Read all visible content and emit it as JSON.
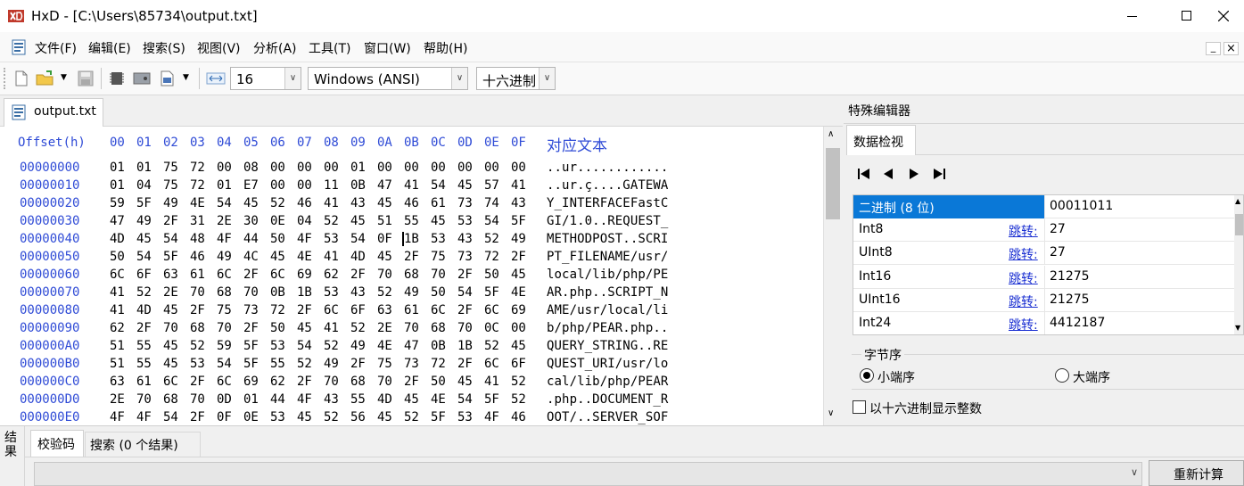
{
  "window": {
    "title": "HxD - [C:\\Users\\85734\\output.txt]",
    "minimize": "—",
    "maximize": "☐",
    "close": "✕"
  },
  "menu": {
    "items": [
      "文件(F)",
      "编辑(E)",
      "搜索(S)",
      "视图(V)",
      "分析(A)",
      "工具(T)",
      "窗口(W)",
      "帮助(H)"
    ],
    "mdi_min": "_",
    "mdi_close": "×"
  },
  "toolbar": {
    "bytes_per_row": "16",
    "charset": "Windows (ANSI)",
    "offset_base": "十六进制"
  },
  "tabs": {
    "file_tab": "output.txt"
  },
  "hex": {
    "offset_header": "Offset(h)",
    "column_headers": [
      "00",
      "01",
      "02",
      "03",
      "04",
      "05",
      "06",
      "07",
      "08",
      "09",
      "0A",
      "0B",
      "0C",
      "0D",
      "0E",
      "0F"
    ],
    "text_header": "对应文本",
    "rows": [
      {
        "offset": "00000000",
        "bytes": [
          "01",
          "01",
          "75",
          "72",
          "00",
          "08",
          "00",
          "00",
          "00",
          "01",
          "00",
          "00",
          "00",
          "00",
          "00",
          "00"
        ],
        "text": "..ur............"
      },
      {
        "offset": "00000010",
        "bytes": [
          "01",
          "04",
          "75",
          "72",
          "01",
          "E7",
          "00",
          "00",
          "11",
          "0B",
          "47",
          "41",
          "54",
          "45",
          "57",
          "41"
        ],
        "text": "..ur.ç....GATEWA"
      },
      {
        "offset": "00000020",
        "bytes": [
          "59",
          "5F",
          "49",
          "4E",
          "54",
          "45",
          "52",
          "46",
          "41",
          "43",
          "45",
          "46",
          "61",
          "73",
          "74",
          "43"
        ],
        "text": "Y_INTERFACEFastC"
      },
      {
        "offset": "00000030",
        "bytes": [
          "47",
          "49",
          "2F",
          "31",
          "2E",
          "30",
          "0E",
          "04",
          "52",
          "45",
          "51",
          "55",
          "45",
          "53",
          "54",
          "5F"
        ],
        "text": "GI/1.0..REQUEST_"
      },
      {
        "offset": "00000040",
        "bytes": [
          "4D",
          "45",
          "54",
          "48",
          "4F",
          "44",
          "50",
          "4F",
          "53",
          "54",
          "0F",
          "1B",
          "53",
          "43",
          "52",
          "49"
        ],
        "text": "METHODPOST..SCRI"
      },
      {
        "offset": "00000050",
        "bytes": [
          "50",
          "54",
          "5F",
          "46",
          "49",
          "4C",
          "45",
          "4E",
          "41",
          "4D",
          "45",
          "2F",
          "75",
          "73",
          "72",
          "2F"
        ],
        "text": "PT_FILENAME/usr/"
      },
      {
        "offset": "00000060",
        "bytes": [
          "6C",
          "6F",
          "63",
          "61",
          "6C",
          "2F",
          "6C",
          "69",
          "62",
          "2F",
          "70",
          "68",
          "70",
          "2F",
          "50",
          "45"
        ],
        "text": "local/lib/php/PE"
      },
      {
        "offset": "00000070",
        "bytes": [
          "41",
          "52",
          "2E",
          "70",
          "68",
          "70",
          "0B",
          "1B",
          "53",
          "43",
          "52",
          "49",
          "50",
          "54",
          "5F",
          "4E"
        ],
        "text": "AR.php..SCRIPT_N"
      },
      {
        "offset": "00000080",
        "bytes": [
          "41",
          "4D",
          "45",
          "2F",
          "75",
          "73",
          "72",
          "2F",
          "6C",
          "6F",
          "63",
          "61",
          "6C",
          "2F",
          "6C",
          "69"
        ],
        "text": "AME/usr/local/li"
      },
      {
        "offset": "00000090",
        "bytes": [
          "62",
          "2F",
          "70",
          "68",
          "70",
          "2F",
          "50",
          "45",
          "41",
          "52",
          "2E",
          "70",
          "68",
          "70",
          "0C",
          "00"
        ],
        "text": "b/php/PEAR.php.."
      },
      {
        "offset": "000000A0",
        "bytes": [
          "51",
          "55",
          "45",
          "52",
          "59",
          "5F",
          "53",
          "54",
          "52",
          "49",
          "4E",
          "47",
          "0B",
          "1B",
          "52",
          "45"
        ],
        "text": "QUERY_STRING..RE"
      },
      {
        "offset": "000000B0",
        "bytes": [
          "51",
          "55",
          "45",
          "53",
          "54",
          "5F",
          "55",
          "52",
          "49",
          "2F",
          "75",
          "73",
          "72",
          "2F",
          "6C",
          "6F"
        ],
        "text": "QUEST_URI/usr/lo"
      },
      {
        "offset": "000000C0",
        "bytes": [
          "63",
          "61",
          "6C",
          "2F",
          "6C",
          "69",
          "62",
          "2F",
          "70",
          "68",
          "70",
          "2F",
          "50",
          "45",
          "41",
          "52"
        ],
        "text": "cal/lib/php/PEAR"
      },
      {
        "offset": "000000D0",
        "bytes": [
          "2E",
          "70",
          "68",
          "70",
          "0D",
          "01",
          "44",
          "4F",
          "43",
          "55",
          "4D",
          "45",
          "4E",
          "54",
          "5F",
          "52"
        ],
        "text": ".php..DOCUMENT_R"
      },
      {
        "offset": "000000E0",
        "bytes": [
          "4F",
          "4F",
          "54",
          "2F",
          "0F",
          "0E",
          "53",
          "45",
          "52",
          "56",
          "45",
          "52",
          "5F",
          "53",
          "4F",
          "46"
        ],
        "text": "OOT/..SERVER_SOF"
      }
    ]
  },
  "special_editor": {
    "title": "特殊编辑器",
    "tab": "数据检视",
    "rows": [
      {
        "label": "二进制 (8 位)",
        "jump": "",
        "value": "00011011",
        "selected": true
      },
      {
        "label": "Int8",
        "jump": "跳转:",
        "value": "27"
      },
      {
        "label": "UInt8",
        "jump": "跳转:",
        "value": "27"
      },
      {
        "label": "Int16",
        "jump": "跳转:",
        "value": "21275"
      },
      {
        "label": "UInt16",
        "jump": "跳转:",
        "value": "21275"
      },
      {
        "label": "Int24",
        "jump": "跳转:",
        "value": "4412187"
      }
    ],
    "byte_order_label": "字节序",
    "little_endian": "小端序",
    "big_endian": "大端序",
    "hex_ints_label": "以十六进制显示整数"
  },
  "results": {
    "side_label_1": "结",
    "side_label_2": "果",
    "tab_checksum": "校验码",
    "tab_search": "搜索 (0 个结果)",
    "recalc_button": "重新计算"
  },
  "colors": {
    "accent": "#0a78d7",
    "hex_blue": "#2f4bd6",
    "link": "#1a2fd2"
  }
}
